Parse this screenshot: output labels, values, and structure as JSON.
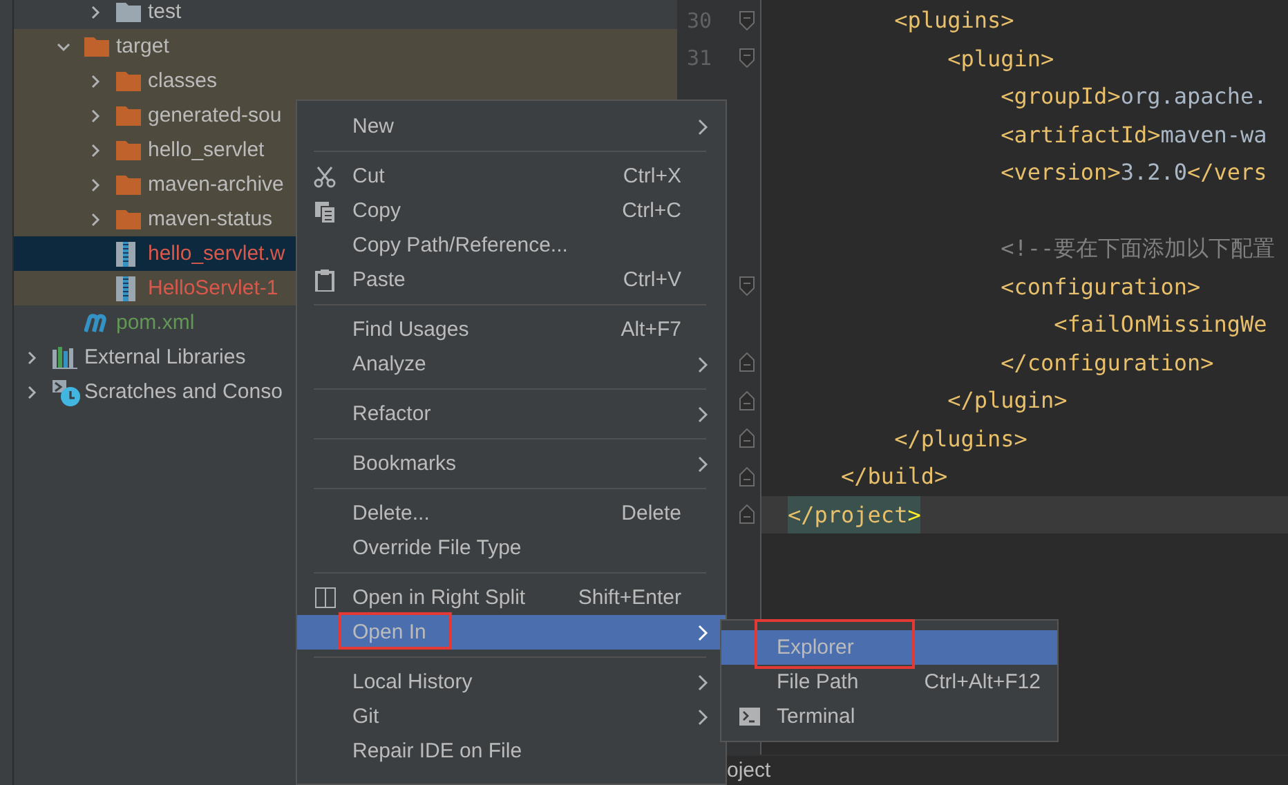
{
  "project_tree": [
    {
      "kind": "group",
      "children": [
        {
          "kind": "group",
          "children": [
            {
              "kind": "folder",
              "label": "test",
              "expanded": false,
              "excluded": false,
              "selected": false
            }
          ]
        },
        {
          "kind": "folder",
          "label": "target",
          "expanded": true,
          "excluded": true,
          "selected": false,
          "children": [
            {
              "kind": "folder",
              "label": "classes",
              "expanded": false,
              "excluded": true,
              "selected": false
            },
            {
              "kind": "folder",
              "label": "generated-sou",
              "expanded": false,
              "excluded": true,
              "selected": false
            },
            {
              "kind": "folder",
              "label": "hello_servlet",
              "expanded": false,
              "excluded": true,
              "selected": false
            },
            {
              "kind": "folder",
              "label": "maven-archive",
              "expanded": false,
              "excluded": true,
              "selected": false
            },
            {
              "kind": "folder",
              "label": "maven-status",
              "expanded": false,
              "excluded": true,
              "selected": false
            },
            {
              "kind": "archive",
              "label": "hello_servlet.w",
              "excluded": true,
              "selected": true,
              "color": "#d9584c"
            },
            {
              "kind": "archive",
              "label": "HelloServlet-1",
              "excluded": true,
              "selected": false,
              "color": "#d9584c"
            }
          ]
        },
        {
          "kind": "maven",
          "label": "pom.xml",
          "excluded": false,
          "selected": false,
          "color": "#629755"
        }
      ]
    },
    {
      "kind": "library",
      "label": "External Libraries",
      "expanded": false,
      "excluded": false,
      "selected": false
    },
    {
      "kind": "scratch",
      "label": "Scratches and Conso",
      "expanded": false,
      "excluded": false,
      "selected": false
    }
  ],
  "editor": {
    "lines": [
      {
        "kind": "group",
        "children": [
          {
            "kind": "group",
            "children": [
              {
                "kind": "opening",
                "number": "30",
                "current": false,
                "tokens": [
                  {
                    "kind": "tag",
                    "text": "<plugins>"
                  }
                ],
                "children": [
                  {
                    "kind": "opening",
                    "number": "31",
                    "current": false,
                    "tokens": [
                      {
                        "kind": "tag",
                        "text": "<plugin>"
                      }
                    ],
                    "children": [
                      {
                        "current": false,
                        "tokens": [
                          {
                            "kind": "tag",
                            "text": "<groupId>"
                          },
                          {
                            "kind": "plain",
                            "text": "org.apache."
                          }
                        ]
                      },
                      {
                        "current": false,
                        "tokens": [
                          {
                            "kind": "tag",
                            "text": "<artifactId>"
                          },
                          {
                            "kind": "plain",
                            "text": "maven-wa"
                          }
                        ]
                      },
                      {
                        "current": false,
                        "tokens": [
                          {
                            "kind": "tag",
                            "text": "<version>"
                          },
                          {
                            "kind": "plain",
                            "text": "3.2.0"
                          },
                          {
                            "kind": "tag",
                            "text": "</vers"
                          }
                        ]
                      },
                      {
                        "current": false
                      },
                      {
                        "current": false,
                        "tokens": [
                          {
                            "kind": "comment",
                            "text": "<!--要在下面添加以下配置"
                          }
                        ]
                      },
                      {
                        "kind": "opening",
                        "current": false,
                        "tokens": [
                          {
                            "kind": "tag",
                            "text": "<configuration>"
                          }
                        ],
                        "children": [
                          {
                            "current": false,
                            "tokens": [
                              {
                                "kind": "tag",
                                "text": "<failOnMissingWe"
                              }
                            ]
                          }
                        ]
                      },
                      {
                        "kind": "closing",
                        "current": false,
                        "tokens": [
                          {
                            "kind": "tag",
                            "text": "</configuration>"
                          }
                        ]
                      }
                    ]
                  },
                  {
                    "kind": "closing",
                    "current": false,
                    "tokens": [
                      {
                        "kind": "tag",
                        "text": "</plugin>"
                      }
                    ]
                  }
                ]
              },
              {
                "kind": "closing",
                "current": false,
                "tokens": [
                  {
                    "kind": "tag",
                    "text": "</plugins>"
                  }
                ]
              }
            ]
          },
          {
            "kind": "closing",
            "current": false,
            "tokens": [
              {
                "kind": "tag",
                "text": "</build>"
              }
            ]
          }
        ]
      },
      {
        "kind": "closing",
        "current": true,
        "tokens": [
          {
            "kind": "match",
            "text": "</project"
          },
          {
            "kind": "match-bracket",
            "text": ">"
          }
        ]
      }
    ],
    "breadcrumb": "oject"
  },
  "context_menu": {
    "items": [
      {
        "kind": "item",
        "label": "New",
        "submenu": true,
        "selected": false,
        "marked": false
      },
      {
        "kind": "separator"
      },
      {
        "kind": "cut",
        "label": "Cut",
        "shortcut": "Ctrl+X",
        "submenu": false,
        "selected": false,
        "marked": false
      },
      {
        "kind": "copy",
        "label": "Copy",
        "shortcut": "Ctrl+C",
        "submenu": false,
        "selected": false,
        "marked": false
      },
      {
        "kind": "item",
        "label": "Copy Path/Reference...",
        "submenu": false,
        "selected": false,
        "marked": false
      },
      {
        "kind": "paste",
        "label": "Paste",
        "shortcut": "Ctrl+V",
        "submenu": false,
        "selected": false,
        "marked": false
      },
      {
        "kind": "separator"
      },
      {
        "kind": "item",
        "label": "Find Usages",
        "shortcut": "Alt+F7",
        "submenu": false,
        "selected": false,
        "marked": false
      },
      {
        "kind": "item",
        "label": "Analyze",
        "submenu": true,
        "selected": false,
        "marked": false
      },
      {
        "kind": "separator"
      },
      {
        "kind": "item",
        "label": "Refactor",
        "submenu": true,
        "selected": false,
        "marked": false
      },
      {
        "kind": "separator"
      },
      {
        "kind": "item",
        "label": "Bookmarks",
        "submenu": true,
        "selected": false,
        "marked": false
      },
      {
        "kind": "separator"
      },
      {
        "kind": "item",
        "label": "Delete...",
        "shortcut": "Delete",
        "submenu": false,
        "selected": false,
        "marked": false
      },
      {
        "kind": "item",
        "label": "Override File Type",
        "submenu": false,
        "selected": false,
        "marked": false
      },
      {
        "kind": "separator"
      },
      {
        "kind": "split",
        "label": "Open in Right Split",
        "shortcut": "Shift+Enter",
        "submenu": false,
        "selected": false,
        "marked": false
      },
      {
        "kind": "item",
        "label": "Open In",
        "submenu": true,
        "selected": true,
        "marked": true
      },
      {
        "kind": "separator"
      },
      {
        "kind": "item",
        "label": "Local History",
        "submenu": true,
        "selected": false,
        "marked": false
      },
      {
        "kind": "item",
        "label": "Git",
        "submenu": true,
        "selected": false,
        "marked": false
      },
      {
        "kind": "item",
        "label": "Repair IDE on File",
        "submenu": false,
        "selected": false,
        "marked": false
      }
    ]
  },
  "submenu": {
    "items": [
      {
        "kind": "item",
        "label": "Explorer",
        "selected": true,
        "marked": true
      },
      {
        "kind": "item",
        "label": "File Path",
        "shortcut": "Ctrl+Alt+F12",
        "selected": false,
        "marked": false
      },
      {
        "kind": "terminal",
        "label": "Terminal",
        "selected": false,
        "marked": false
      }
    ]
  }
}
